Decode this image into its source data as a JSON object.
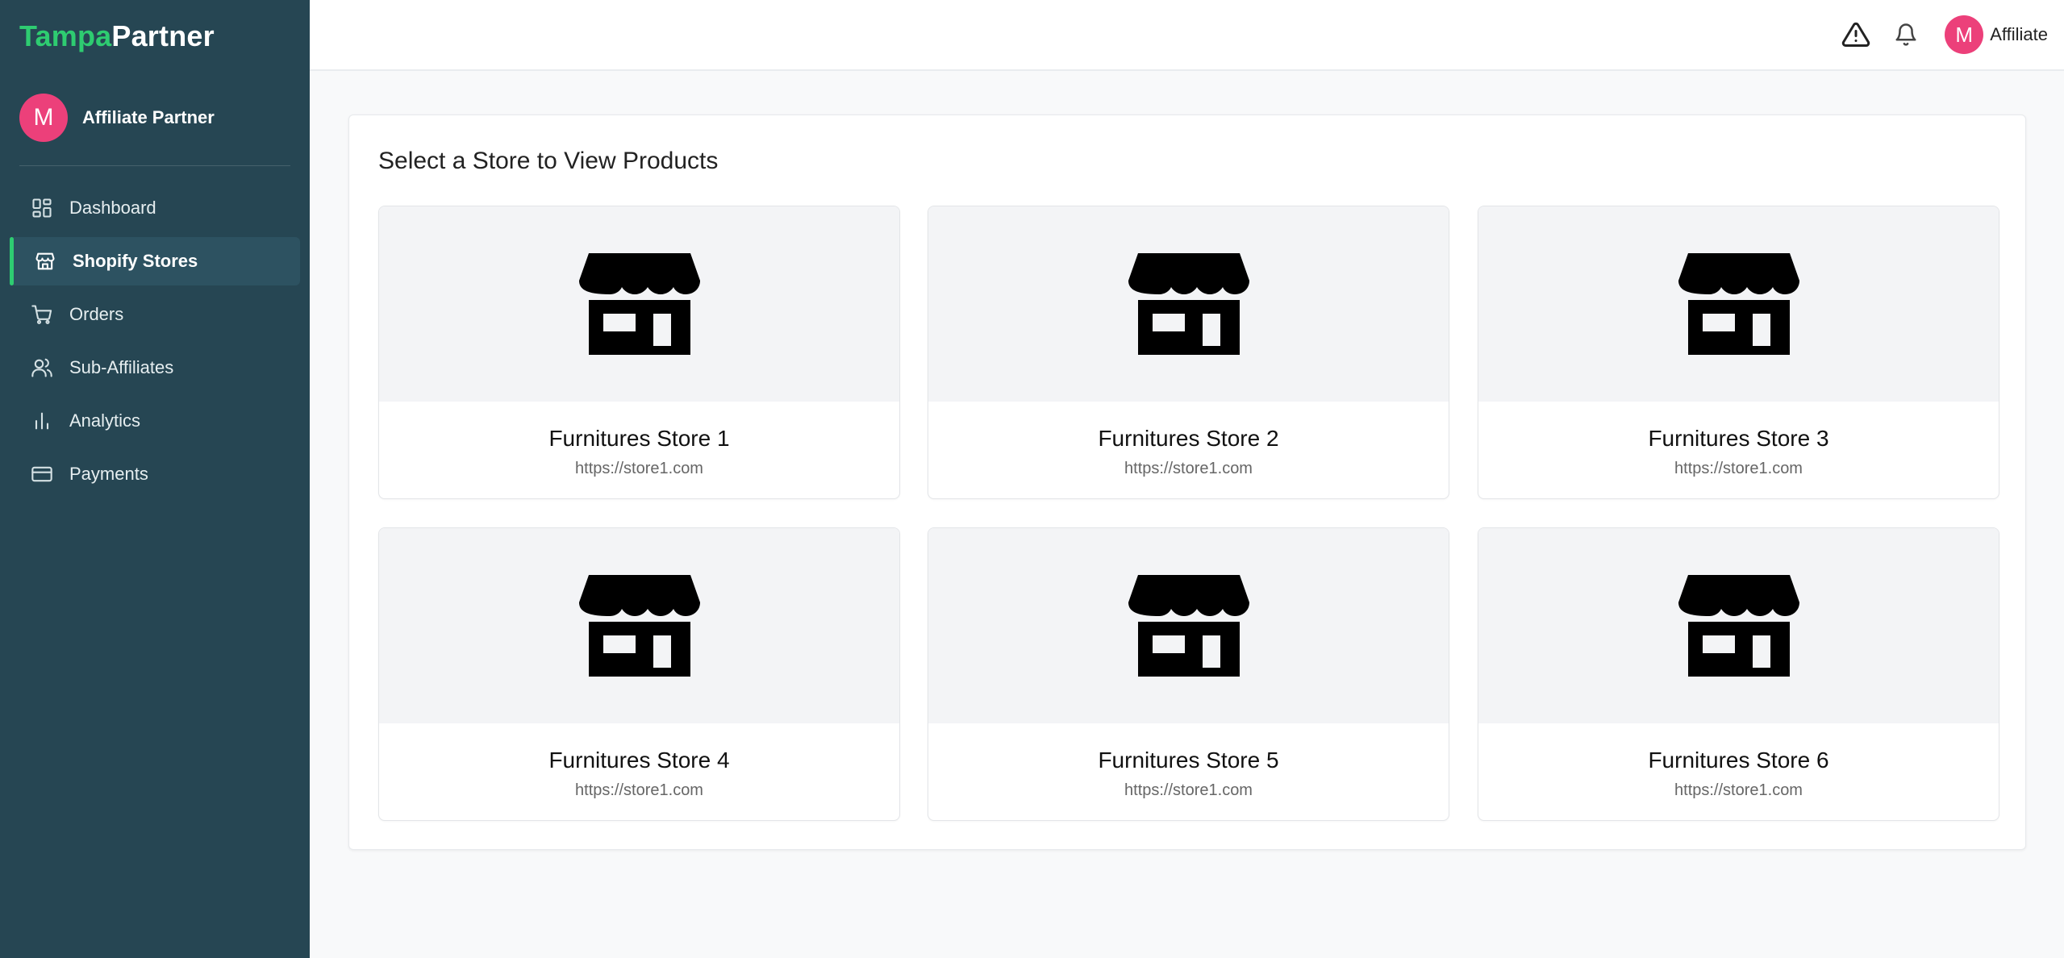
{
  "brand": {
    "part1": "Tampa",
    "part2": "Partner"
  },
  "sidebar": {
    "profile": {
      "initial": "M",
      "name": "Affiliate Partner"
    },
    "items": [
      {
        "label": "Dashboard",
        "icon": "grid-icon"
      },
      {
        "label": "Shopify Stores",
        "icon": "store-icon"
      },
      {
        "label": "Orders",
        "icon": "cart-icon"
      },
      {
        "label": "Sub-Affiliates",
        "icon": "users-icon"
      },
      {
        "label": "Analytics",
        "icon": "bar-chart-icon"
      },
      {
        "label": "Payments",
        "icon": "credit-card-icon"
      }
    ]
  },
  "header": {
    "user_initial": "M",
    "user_label": "Affiliate"
  },
  "main": {
    "title": "Select a Store to View Products",
    "stores": [
      {
        "name": "Furnitures Store 1",
        "url": "https://store1.com"
      },
      {
        "name": "Furnitures Store 2",
        "url": "https://store1.com"
      },
      {
        "name": "Furnitures Store 3",
        "url": "https://store1.com"
      },
      {
        "name": "Furnitures Store 4",
        "url": "https://store1.com"
      },
      {
        "name": "Furnitures Store 5",
        "url": "https://store1.com"
      },
      {
        "name": "Furnitures Store 6",
        "url": "https://store1.com"
      }
    ]
  },
  "colors": {
    "sidebar_bg": "#264653",
    "accent": "#2ecc71",
    "avatar": "#ec407a"
  }
}
